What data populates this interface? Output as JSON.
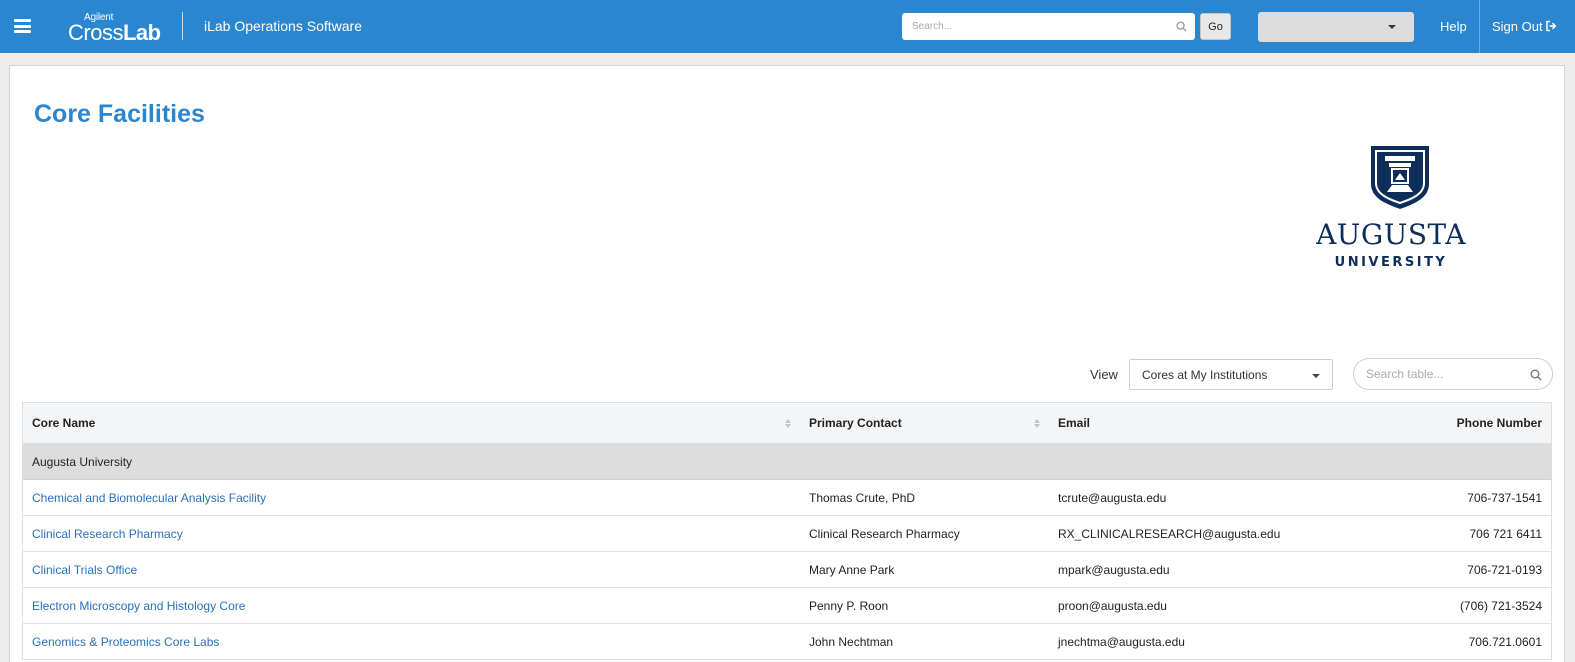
{
  "header": {
    "brand_small": "Agilent",
    "brand_cross": "Cross",
    "brand_lab": "Lab",
    "app_title": "iLab Operations Software",
    "search_placeholder": "Search...",
    "go_label": "Go",
    "institution_selected": "",
    "help_label": "Help",
    "signout_label": "Sign Out",
    "bar_color": "#2a86cf"
  },
  "page": {
    "title": "Core Facilities",
    "logo_word": "AUGUSTA",
    "logo_sub": "UNIVERSITY",
    "logo_color": "#0e2e5a"
  },
  "controls": {
    "view_label": "View",
    "view_selected": "Cores at My Institutions",
    "table_search_placeholder": "Search table..."
  },
  "table": {
    "columns": [
      "Core Name",
      "Primary Contact",
      "Email",
      "Phone Number"
    ],
    "group": "Augusta University",
    "rows": [
      [
        "Chemical and Biomolecular Analysis Facility",
        "Thomas Crute, PhD",
        "tcrute@augusta.edu",
        "706-737-1541"
      ],
      [
        "Clinical Research Pharmacy",
        "Clinical Research Pharmacy",
        "RX_CLINICALRESEARCH@augusta.edu",
        "706 721 6411"
      ],
      [
        "Clinical Trials Office",
        "Mary Anne Park",
        "mpark@augusta.edu",
        "706-721-0193"
      ],
      [
        "Electron Microscopy and Histology Core",
        "Penny P. Roon",
        "proon@augusta.edu",
        "(706) 721-3524"
      ],
      [
        "Genomics & Proteomics Core Labs",
        "John Nechtman",
        "jnechtma@augusta.edu",
        "706.721.0601"
      ]
    ]
  }
}
